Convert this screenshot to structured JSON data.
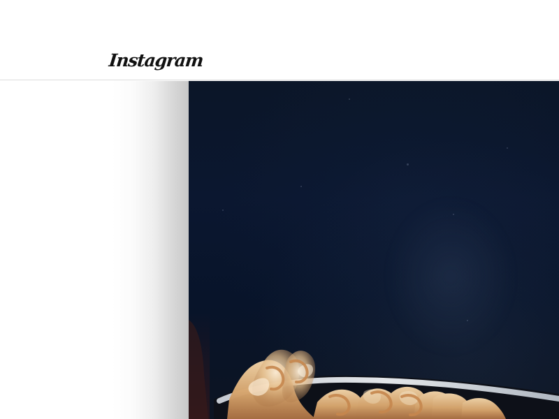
{
  "header": {
    "logo_text": "Instagram"
  },
  "media": {
    "subject": "pasta-dish",
    "background_color": "#0b1628"
  },
  "theme": {
    "page_background": "#ffffff",
    "divider_color": "#dbdbdb",
    "logo_color": "#111111"
  }
}
